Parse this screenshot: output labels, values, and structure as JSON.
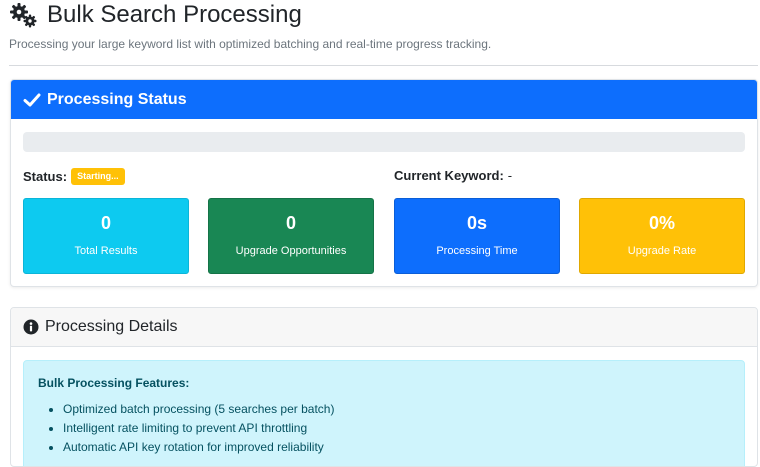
{
  "page": {
    "title": "Bulk Search Processing",
    "subtitle": "Processing your large keyword list with optimized batching and real-time progress tracking."
  },
  "status_card": {
    "header": "Processing Status",
    "progress_fraction": 0,
    "status_label": "Status:",
    "status_badge": "Starting...",
    "keyword_label": "Current Keyword:",
    "keyword_value": "-",
    "stats": [
      {
        "value": "0",
        "label": "Total Results",
        "color": "#0dcaf0"
      },
      {
        "value": "0",
        "label": "Upgrade Opportunities",
        "color": "#198754"
      },
      {
        "value": "0s",
        "label": "Processing Time",
        "color": "#0d6efd"
      },
      {
        "value": "0%",
        "label": "Upgrade Rate",
        "color": "#ffc107"
      }
    ]
  },
  "details_card": {
    "header": "Processing Details",
    "features_title": "Bulk Processing Features:",
    "features": [
      "Optimized batch processing (5 searches per batch)",
      "Intelligent rate limiting to prevent API throttling",
      "Automatic API key rotation for improved reliability"
    ]
  },
  "icons": {
    "title_icon": "gears-icon",
    "status_header_icon": "check-icon",
    "details_header_icon": "info-circle-icon"
  },
  "colors": {
    "primary": "#0d6efd",
    "info": "#0dcaf0",
    "success": "#198754",
    "warning": "#ffc107",
    "alert_bg": "#cff4fc",
    "alert_text": "#055160"
  }
}
